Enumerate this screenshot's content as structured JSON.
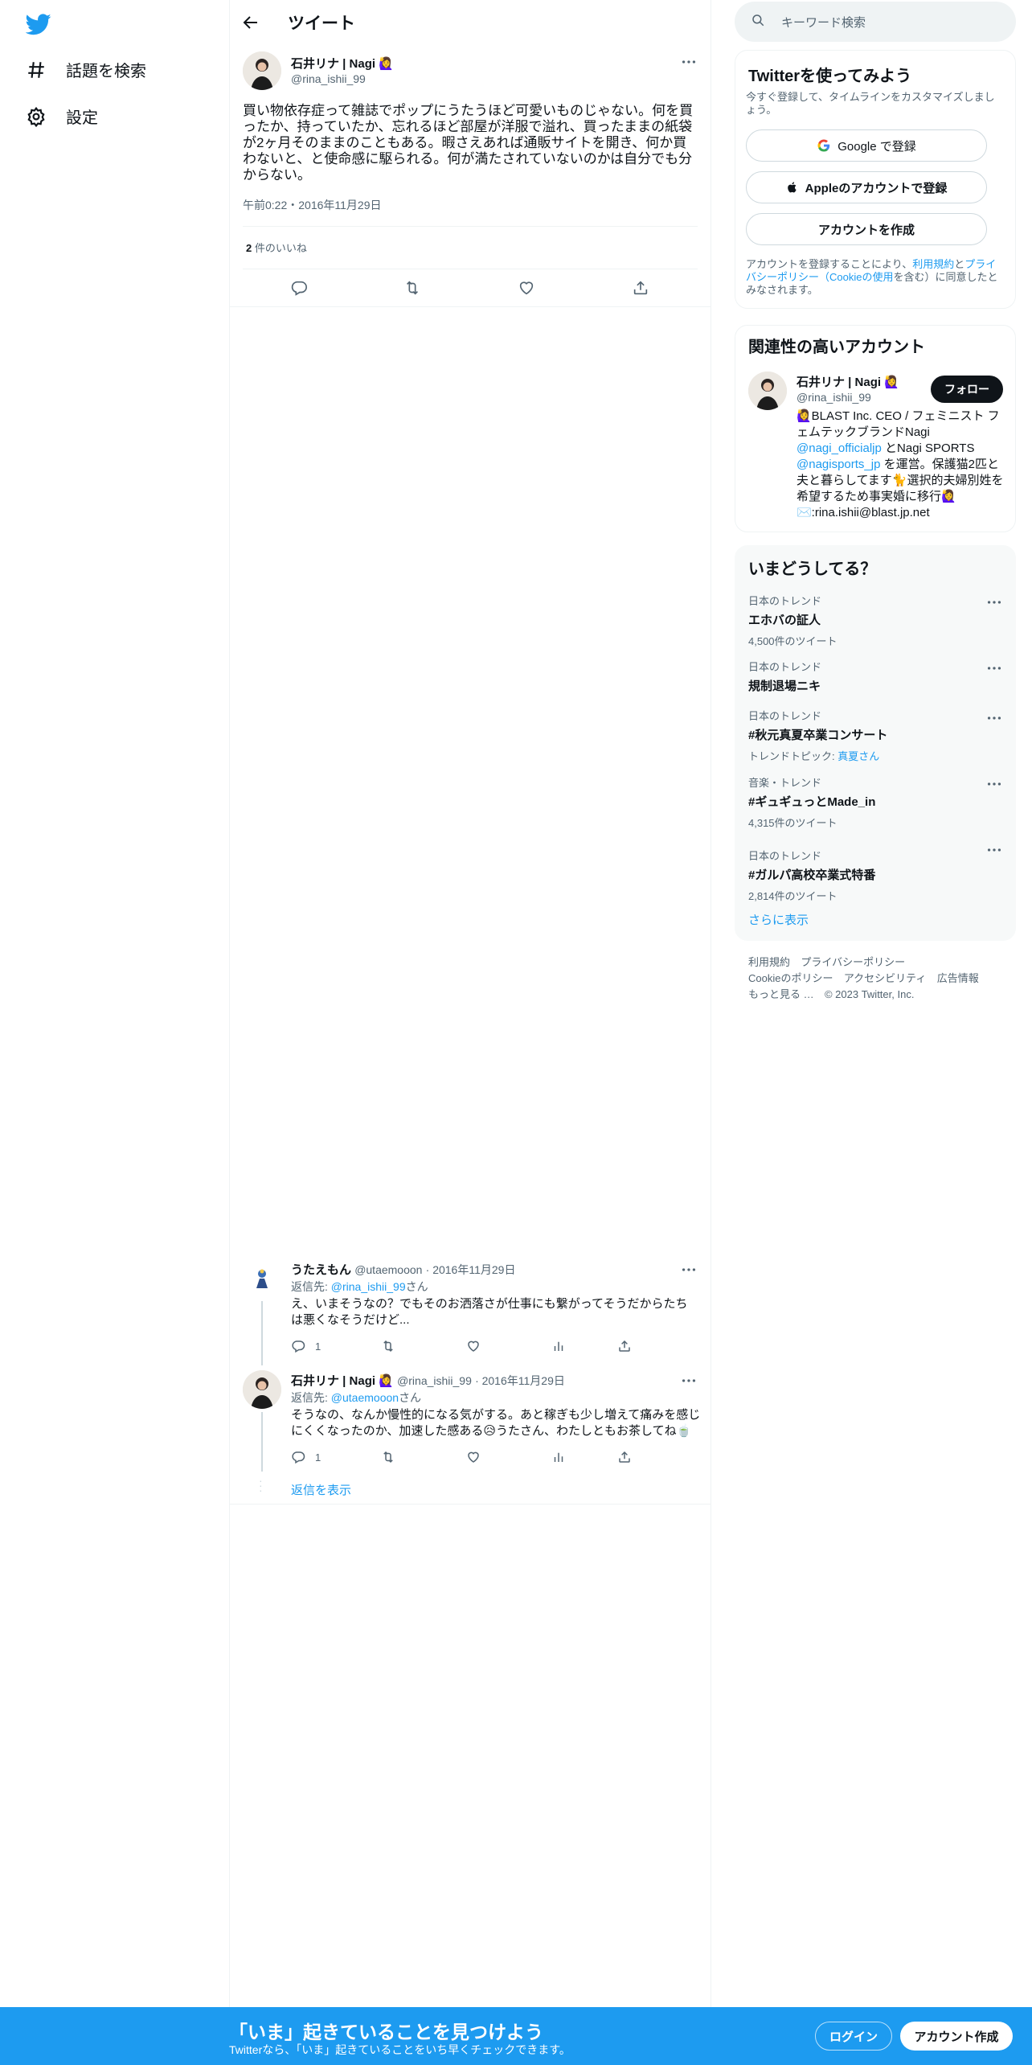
{
  "nav": {
    "explore": "話題を検索",
    "settings": "設定"
  },
  "header": {
    "title": "ツイート"
  },
  "tweet": {
    "author_name": "石井リナ | Nagi 🙋‍♀️",
    "author_handle": "@rina_ishii_99",
    "text": "買い物依存症って雑誌でポップにうたうほど可愛いものじゃない。何を買ったか、持っていたか、忘れるほど部屋が洋服で溢れ、買ったままの紙袋が2ヶ月そのままのこともある。暇さえあれば通販サイトを開き、何か買わないと、と使命感に駆られる。何が満たされていないのかは自分でも分からない。",
    "timestamp": "午前0:22・2016年11月29日",
    "likes_count": "2",
    "likes_label": "件のいいね"
  },
  "replies": [
    {
      "name": "うたえもん",
      "handle": "@utaemooon",
      "date": "· 2016年11月29日",
      "reply_to_label": "返信先:",
      "reply_to_handle": "@rina_ishii_99",
      "reply_to_suffix": "さん",
      "text": "え、いまそうなの？でもそのお洒落さが仕事にも繋がってそうだからたちは悪くなそうだけど...",
      "reply_count": "1"
    },
    {
      "name": "石井リナ | Nagi 🙋‍♀️",
      "handle": "@rina_ishii_99",
      "date": "· 2016年11月29日",
      "reply_to_label": "返信先:",
      "reply_to_handle": "@utaemooon",
      "reply_to_suffix": "さん",
      "text": "そうなの、なんか慢性的になる気がする。あと稼ぎも少し増えて痛みを感じにくくなったのか、加速した感ある😥うたさん、わたしともお茶してね🍵",
      "reply_count": "1"
    }
  ],
  "show_replies": "返信を表示",
  "search": {
    "placeholder": "キーワード検索"
  },
  "signup_card": {
    "title": "Twitterを使ってみよう",
    "subtitle": "今すぐ登録して、タイムラインをカスタマイズしましょう。",
    "google": "Google で登録",
    "apple": "Appleのアカウントで登録",
    "create": "アカウントを作成",
    "legal_1": "アカウントを登録することにより、",
    "legal_terms": "利用規約",
    "legal_and": "と",
    "legal_privacy": "プライバシーポリシー（Cookieの使用",
    "legal_end": "を含む）に同意したとみなされます。"
  },
  "related": {
    "title": "関連性の高いアカウント",
    "name": "石井リナ | Nagi 🙋‍♀️",
    "handle": "@rina_ishii_99",
    "follow": "フォロー",
    "bio_1": "🙋‍♀️BLAST Inc. CEO / フェミニスト フェムテックブランドNagi",
    "bio_link1": "@nagi_officialjp",
    "bio_2": " とNagi SPORTS",
    "bio_link2": "@nagisports_jp",
    "bio_3": " を運営。保護猫2匹と夫と暮らしてます🐈選択的夫婦別姓を希望するため事実婚に移行🙋‍♀️✉️:rina.ishii@blast.jp.net"
  },
  "trends": {
    "title": "いまどうしてる？",
    "items": [
      {
        "meta": "日本のトレンド",
        "title": "エホバの証人",
        "sub": "4,500件のツイート"
      },
      {
        "meta": "日本のトレンド",
        "title": "規制退場ニキ",
        "sub": ""
      },
      {
        "meta": "日本のトレンド",
        "title": "#秋元真夏卒業コンサート",
        "sub": "トレンドトピック:",
        "sub_link": "真夏さん"
      },
      {
        "meta": "音楽・トレンド",
        "title": "#ギュギュっとMade_in",
        "sub": "4,315件のツイート"
      },
      {
        "meta": "日本のトレンド",
        "title": "#ガルパ高校卒業式特番",
        "sub": "2,814件のツイート"
      }
    ],
    "show_more": "さらに表示"
  },
  "footer": {
    "terms": "利用規約",
    "privacy": "プライバシーポリシー",
    "cookie": "Cookieのポリシー",
    "accessibility": "アクセシビリティ",
    "ads": "広告情報",
    "more": "もっと見る …",
    "copyright": "© 2023 Twitter, Inc."
  },
  "bottom_bar": {
    "title": "「いま」起きていることを見つけよう",
    "subtitle": "Twitterなら、「いま」起きていることをいち早くチェックできます。",
    "login": "ログイン",
    "signup": "アカウント作成"
  },
  "colors": {
    "brand": "#1d9bf0",
    "text": "#0f1419",
    "muted": "#536471",
    "border": "#eff3f4"
  }
}
